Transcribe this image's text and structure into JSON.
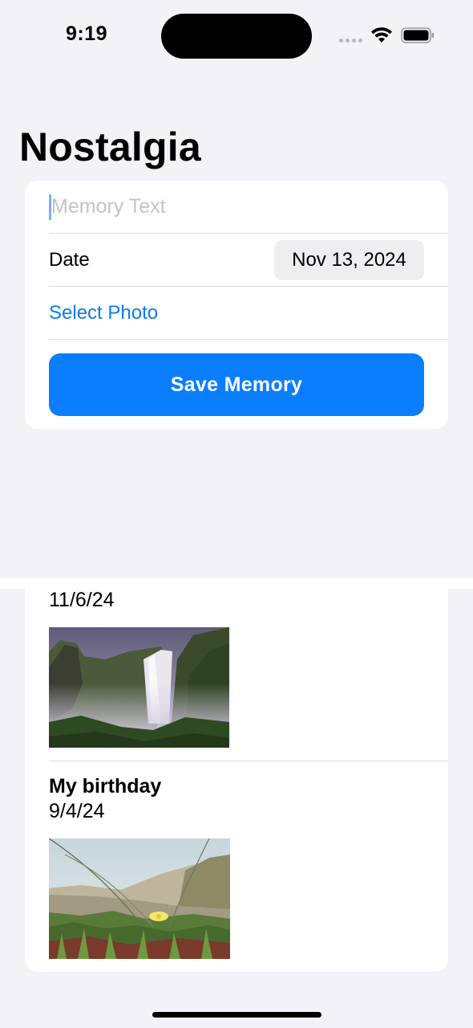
{
  "status_bar": {
    "time": "9:19"
  },
  "app": {
    "title": "Nostalgia"
  },
  "form": {
    "memory_text_placeholder": "Memory Text",
    "date_label": "Date",
    "date_value": "Nov 13, 2024",
    "select_photo_label": "Select Photo",
    "save_button_label": "Save Memory"
  },
  "memories": [
    {
      "title": "",
      "date": "11/6/24",
      "photo": "waterfall-photo"
    },
    {
      "title": "My birthday",
      "date": "9/4/24",
      "photo": "beach-succulent-photo"
    }
  ],
  "colors": {
    "accent": "#0a7eff",
    "background": "#f2f2f7",
    "link": "#0a7bf0"
  }
}
